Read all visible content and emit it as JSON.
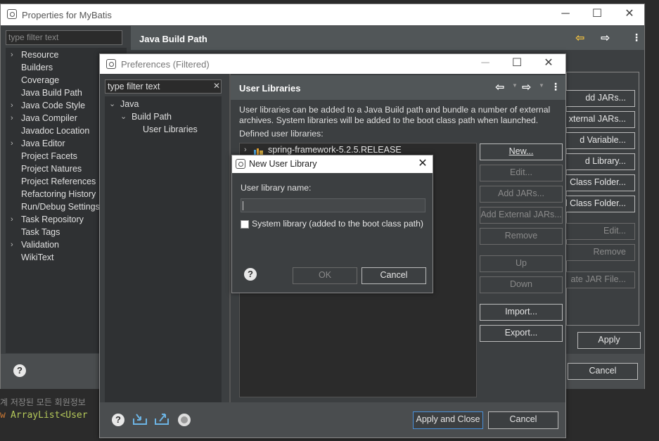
{
  "properties_window": {
    "title": "Properties for MyBatis",
    "filter_placeholder": "type filter text",
    "header": "Java Build Path",
    "tree": [
      {
        "label": "Resource",
        "expandable": true
      },
      {
        "label": "Builders",
        "expandable": false
      },
      {
        "label": "Coverage",
        "expandable": false
      },
      {
        "label": "Java Build Path",
        "expandable": false
      },
      {
        "label": "Java Code Style",
        "expandable": true
      },
      {
        "label": "Java Compiler",
        "expandable": true
      },
      {
        "label": "Javadoc Location",
        "expandable": false
      },
      {
        "label": "Java Editor",
        "expandable": true
      },
      {
        "label": "Project Facets",
        "expandable": false
      },
      {
        "label": "Project Natures",
        "expandable": false
      },
      {
        "label": "Project References",
        "expandable": false
      },
      {
        "label": "Refactoring History",
        "expandable": false
      },
      {
        "label": "Run/Debug Settings",
        "expandable": false
      },
      {
        "label": "Task Repository",
        "expandable": true
      },
      {
        "label": "Task Tags",
        "expandable": false
      },
      {
        "label": "Validation",
        "expandable": true
      },
      {
        "label": "WikiText",
        "expandable": false
      }
    ],
    "side_buttons": [
      "dd JARs...",
      "xternal JARs...",
      "d Variable...",
      "d Library...",
      "Class Folder...",
      "nal Class Folder...",
      "Edit...",
      "Remove",
      "ate JAR File..."
    ],
    "apply": "Apply",
    "cancel": "Cancel"
  },
  "editor_behind": {
    "line1": "계 저장된 모든 회원정보",
    "line2_kw": "w",
    "line2_code": "ArrayList<User"
  },
  "preferences_window": {
    "title": "Preferences (Filtered)",
    "filter_value": "type filter text",
    "tree": [
      {
        "label": "Java",
        "level": 0,
        "expanded": true
      },
      {
        "label": "Build Path",
        "level": 1,
        "expanded": true
      },
      {
        "label": "User Libraries",
        "level": 2,
        "expanded": false
      }
    ],
    "header": "User Libraries",
    "description": "User libraries can be added to a Java Build path and bundle a number of external archives. System libraries will be added to the boot class path when launched.",
    "defined_label": "Defined user libraries:",
    "libraries": [
      "spring-framework-5.2.5.RELEASE"
    ],
    "buttons": {
      "new": "New...",
      "edit": "Edit...",
      "add_jars": "Add JARs...",
      "add_external_jars": "Add External JARs...",
      "remove": "Remove",
      "up": "Up",
      "down": "Down",
      "import": "Import...",
      "export": "Export..."
    },
    "apply_close": "Apply and Close",
    "cancel": "Cancel"
  },
  "new_library_dialog": {
    "title": "New User Library",
    "name_label": "User library name:",
    "name_value": "",
    "system_checkbox_label": "System library (added to the boot class path)",
    "system_checked": false,
    "ok": "OK",
    "cancel": "Cancel"
  },
  "colors": {
    "panel": "#3c3f41",
    "header": "#515658",
    "title_bar": "#ffffff",
    "focus_border": "#4a90d9"
  }
}
